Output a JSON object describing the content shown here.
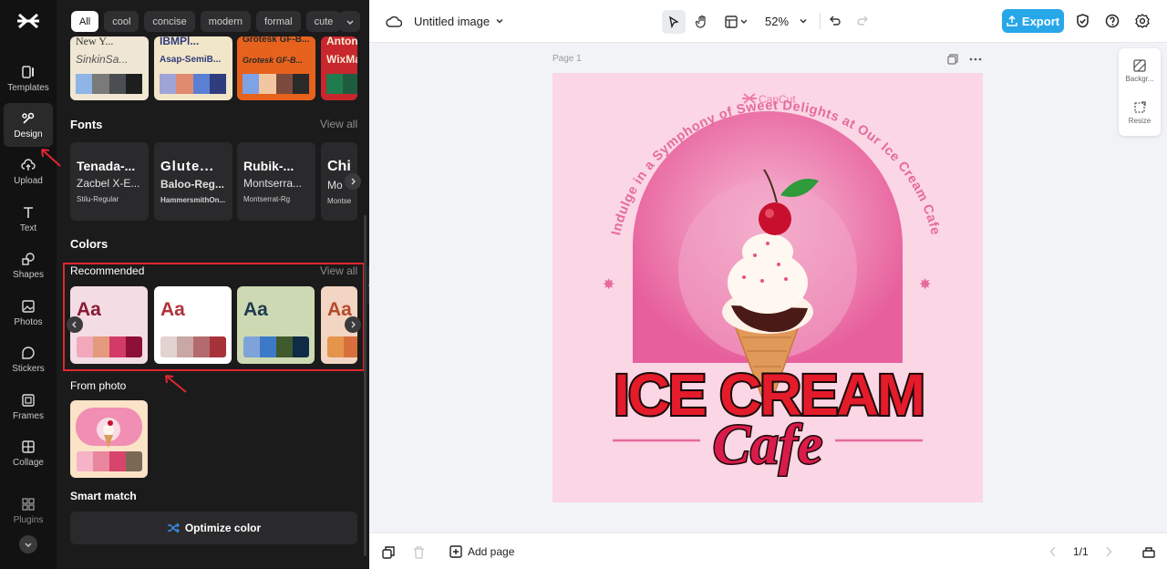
{
  "rail": {
    "items": [
      {
        "label": "Templates"
      },
      {
        "label": "Design"
      },
      {
        "label": "Upload"
      },
      {
        "label": "Text"
      },
      {
        "label": "Shapes"
      },
      {
        "label": "Photos"
      },
      {
        "label": "Stickers"
      },
      {
        "label": "Frames"
      },
      {
        "label": "Collage"
      },
      {
        "label": "Plugins"
      }
    ]
  },
  "panel": {
    "filters": [
      "All",
      "cool",
      "concise",
      "modern",
      "formal",
      "cute"
    ],
    "templates": [
      {
        "top": "New Y...",
        "sub": "SinkinSa...",
        "bg": "#efe7d4",
        "colors": [
          "#8fb4e6",
          "#7a7a7a",
          "#4a4d52",
          "#1e1e1e"
        ]
      },
      {
        "top": "IBMPl...",
        "sub": "Asap-SemiB...",
        "bg": "#f2e6c8",
        "colors": [
          "#9fa4d6",
          "#e08a6e",
          "#5a7fd4",
          "#2f3c7e"
        ]
      },
      {
        "top": "Grotesk GF-B...",
        "sub": "Grotesk GF-B...",
        "bg": "#e7621d",
        "colors": [
          "#7ea2e6",
          "#f2c6a0",
          "#7b4a3c",
          "#2a2a2a"
        ]
      },
      {
        "top": "Anton",
        "sub": "WixMa",
        "bg": "#c8272d",
        "colors": [
          "#1f7c4f",
          "#1d5c3f",
          "#e7d9c0",
          "#222"
        ]
      }
    ],
    "fonts_title": "Fonts",
    "view_all": "View all",
    "fonts": [
      {
        "name": "Tenada-...",
        "pair": "Zacbel X-E...",
        "sub": "Stilu-Regular"
      },
      {
        "name": "Glute...",
        "pair": "Baloo-Reg...",
        "sub": "HammersmithOn..."
      },
      {
        "name": "Rubik-...",
        "pair": "Montserra...",
        "sub": "Montserrat-Rg"
      },
      {
        "name": "Chi",
        "pair": "Mo",
        "sub": "Montser"
      }
    ],
    "colors_title": "Colors",
    "recommended_title": "Recommended",
    "palettes": [
      {
        "aa": "Aa",
        "aa_color": "#8a1a35",
        "bg": "#f3dce3",
        "colors": [
          "#f2a7bb",
          "#e49a7d",
          "#d43a67",
          "#8d1036"
        ]
      },
      {
        "aa": "Aa",
        "aa_color": "#b0333a",
        "bg": "#ffffff",
        "colors": [
          "#e2d3d0",
          "#c9a7a4",
          "#b46b6e",
          "#a8323a"
        ]
      },
      {
        "aa": "Aa",
        "aa_color": "#1f3a4f",
        "bg": "#ccd9b3",
        "colors": [
          "#7ea3d8",
          "#3c7ac8",
          "#3f5a2d",
          "#0f2b46"
        ]
      },
      {
        "aa": "Aa",
        "aa_color": "#b54a2c",
        "bg": "#f2d5c2",
        "colors": [
          "#e5944b",
          "#d86f3d",
          "#c65130",
          "#a33b2a"
        ]
      }
    ],
    "from_photo_title": "From photo",
    "photo_palette": [
      "#f6b2c7",
      "#e9869e",
      "#d7446c",
      "#7a6a55"
    ],
    "smart_match_title": "Smart match",
    "optimize_label": "Optimize color"
  },
  "topbar": {
    "title": "Untitled image",
    "zoom": "52%",
    "export_label": "Export"
  },
  "canvas": {
    "page_label": "Page 1",
    "design": {
      "brand": "CapCut",
      "arc_text": "Indulge in a Symphony of Sweet Delights at Our Ice Cream Cafe",
      "headline": "ICE CREAM",
      "script": "Cafe"
    },
    "side_panel": [
      {
        "label": "Backgr..."
      },
      {
        "label": "Resize"
      }
    ]
  },
  "bottombar": {
    "add_page_label": "Add page",
    "pager": "1/1"
  },
  "colors": {
    "accent": "#27a7e8",
    "highlight": "#e0262f",
    "artboard_bg": "#fbd6e4",
    "arch": "#e35a99"
  }
}
